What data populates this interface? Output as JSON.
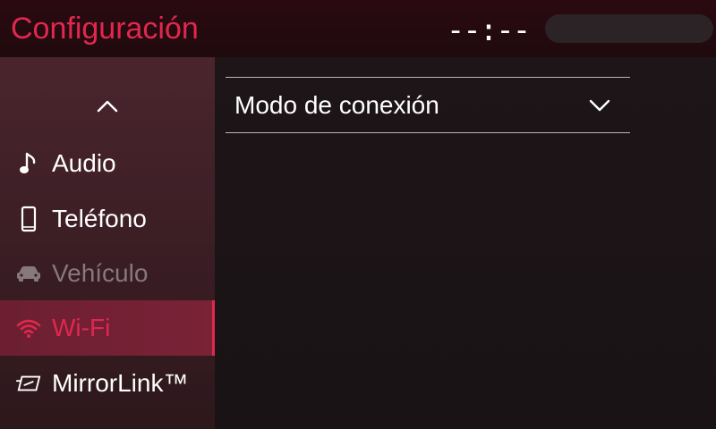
{
  "header": {
    "title": "Configuración",
    "clock": "--:--"
  },
  "sidebar": {
    "scroll_up_icon": "chevron-up-icon",
    "items": [
      {
        "label": "Audio",
        "icon": "music-note-icon",
        "state": "normal"
      },
      {
        "label": "Teléfono",
        "icon": "smartphone-icon",
        "state": "normal"
      },
      {
        "label": "Vehículo",
        "icon": "car-icon",
        "state": "disabled"
      },
      {
        "label": "Wi-Fi",
        "icon": "wifi-icon",
        "state": "selected"
      },
      {
        "label": "MirrorLink™",
        "icon": "mirrorlink-icon",
        "state": "normal"
      }
    ]
  },
  "main": {
    "setting_label": "Modo de conexión",
    "setting_icon": "chevron-down-icon"
  },
  "colors": {
    "accent": "#e0274f",
    "header_bg": "#2a0a10",
    "sidebar_bg": "#3a1d24",
    "selected_bg": "#7a2236",
    "disabled_text": "#86797c",
    "main_bg": "#1c1416"
  }
}
